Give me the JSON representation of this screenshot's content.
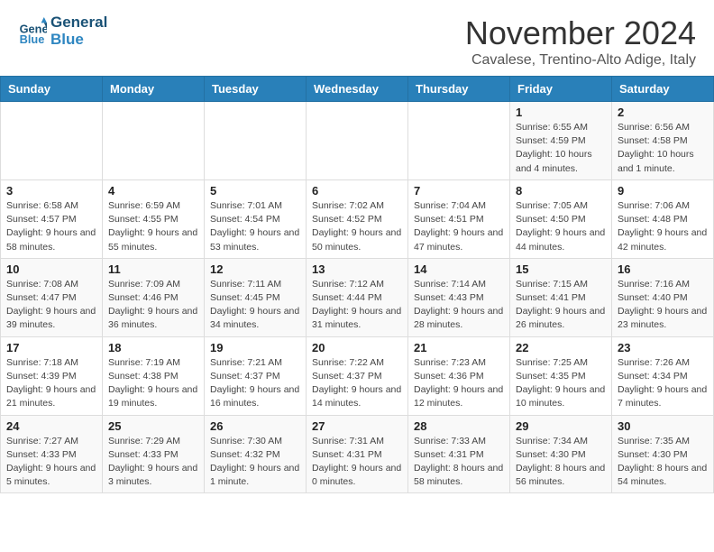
{
  "header": {
    "title": "November 2024",
    "location": "Cavalese, Trentino-Alto Adige, Italy",
    "logo_line1": "General",
    "logo_line2": "Blue"
  },
  "days_of_week": [
    "Sunday",
    "Monday",
    "Tuesday",
    "Wednesday",
    "Thursday",
    "Friday",
    "Saturday"
  ],
  "weeks": [
    [
      {
        "day": "",
        "info": ""
      },
      {
        "day": "",
        "info": ""
      },
      {
        "day": "",
        "info": ""
      },
      {
        "day": "",
        "info": ""
      },
      {
        "day": "",
        "info": ""
      },
      {
        "day": "1",
        "info": "Sunrise: 6:55 AM\nSunset: 4:59 PM\nDaylight: 10 hours and 4 minutes."
      },
      {
        "day": "2",
        "info": "Sunrise: 6:56 AM\nSunset: 4:58 PM\nDaylight: 10 hours and 1 minute."
      }
    ],
    [
      {
        "day": "3",
        "info": "Sunrise: 6:58 AM\nSunset: 4:57 PM\nDaylight: 9 hours and 58 minutes."
      },
      {
        "day": "4",
        "info": "Sunrise: 6:59 AM\nSunset: 4:55 PM\nDaylight: 9 hours and 55 minutes."
      },
      {
        "day": "5",
        "info": "Sunrise: 7:01 AM\nSunset: 4:54 PM\nDaylight: 9 hours and 53 minutes."
      },
      {
        "day": "6",
        "info": "Sunrise: 7:02 AM\nSunset: 4:52 PM\nDaylight: 9 hours and 50 minutes."
      },
      {
        "day": "7",
        "info": "Sunrise: 7:04 AM\nSunset: 4:51 PM\nDaylight: 9 hours and 47 minutes."
      },
      {
        "day": "8",
        "info": "Sunrise: 7:05 AM\nSunset: 4:50 PM\nDaylight: 9 hours and 44 minutes."
      },
      {
        "day": "9",
        "info": "Sunrise: 7:06 AM\nSunset: 4:48 PM\nDaylight: 9 hours and 42 minutes."
      }
    ],
    [
      {
        "day": "10",
        "info": "Sunrise: 7:08 AM\nSunset: 4:47 PM\nDaylight: 9 hours and 39 minutes."
      },
      {
        "day": "11",
        "info": "Sunrise: 7:09 AM\nSunset: 4:46 PM\nDaylight: 9 hours and 36 minutes."
      },
      {
        "day": "12",
        "info": "Sunrise: 7:11 AM\nSunset: 4:45 PM\nDaylight: 9 hours and 34 minutes."
      },
      {
        "day": "13",
        "info": "Sunrise: 7:12 AM\nSunset: 4:44 PM\nDaylight: 9 hours and 31 minutes."
      },
      {
        "day": "14",
        "info": "Sunrise: 7:14 AM\nSunset: 4:43 PM\nDaylight: 9 hours and 28 minutes."
      },
      {
        "day": "15",
        "info": "Sunrise: 7:15 AM\nSunset: 4:41 PM\nDaylight: 9 hours and 26 minutes."
      },
      {
        "day": "16",
        "info": "Sunrise: 7:16 AM\nSunset: 4:40 PM\nDaylight: 9 hours and 23 minutes."
      }
    ],
    [
      {
        "day": "17",
        "info": "Sunrise: 7:18 AM\nSunset: 4:39 PM\nDaylight: 9 hours and 21 minutes."
      },
      {
        "day": "18",
        "info": "Sunrise: 7:19 AM\nSunset: 4:38 PM\nDaylight: 9 hours and 19 minutes."
      },
      {
        "day": "19",
        "info": "Sunrise: 7:21 AM\nSunset: 4:37 PM\nDaylight: 9 hours and 16 minutes."
      },
      {
        "day": "20",
        "info": "Sunrise: 7:22 AM\nSunset: 4:37 PM\nDaylight: 9 hours and 14 minutes."
      },
      {
        "day": "21",
        "info": "Sunrise: 7:23 AM\nSunset: 4:36 PM\nDaylight: 9 hours and 12 minutes."
      },
      {
        "day": "22",
        "info": "Sunrise: 7:25 AM\nSunset: 4:35 PM\nDaylight: 9 hours and 10 minutes."
      },
      {
        "day": "23",
        "info": "Sunrise: 7:26 AM\nSunset: 4:34 PM\nDaylight: 9 hours and 7 minutes."
      }
    ],
    [
      {
        "day": "24",
        "info": "Sunrise: 7:27 AM\nSunset: 4:33 PM\nDaylight: 9 hours and 5 minutes."
      },
      {
        "day": "25",
        "info": "Sunrise: 7:29 AM\nSunset: 4:33 PM\nDaylight: 9 hours and 3 minutes."
      },
      {
        "day": "26",
        "info": "Sunrise: 7:30 AM\nSunset: 4:32 PM\nDaylight: 9 hours and 1 minute."
      },
      {
        "day": "27",
        "info": "Sunrise: 7:31 AM\nSunset: 4:31 PM\nDaylight: 9 hours and 0 minutes."
      },
      {
        "day": "28",
        "info": "Sunrise: 7:33 AM\nSunset: 4:31 PM\nDaylight: 8 hours and 58 minutes."
      },
      {
        "day": "29",
        "info": "Sunrise: 7:34 AM\nSunset: 4:30 PM\nDaylight: 8 hours and 56 minutes."
      },
      {
        "day": "30",
        "info": "Sunrise: 7:35 AM\nSunset: 4:30 PM\nDaylight: 8 hours and 54 minutes."
      }
    ]
  ]
}
